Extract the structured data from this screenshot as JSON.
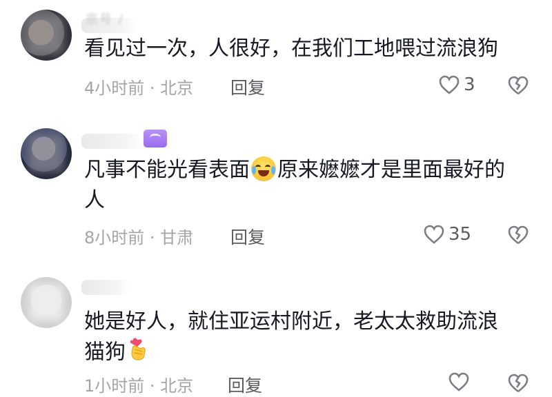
{
  "comments": [
    {
      "user_text": "京号 /",
      "text_lines": [
        "看见过一次，人很好，在我们工地喂过流浪狗"
      ],
      "time_location": "4小时前 · 北京",
      "reply_label": "回复",
      "likes": "3",
      "heart_icon": "heart-outline-icon",
      "dislike_icon": "broken-heart-icon"
    },
    {
      "user_text": "",
      "text_lines": [
        "凡事不能光看表面",
        "原来嬷嬷才是里面最好的",
        "人"
      ],
      "time_location": "8小时前 · 甘肃",
      "reply_label": "回复",
      "likes": "35",
      "badge_color": "#a57ff2",
      "emoji": "tears-of-joy-emoji"
    },
    {
      "user_text": "",
      "text_lines": [
        "她是好人，就住亚运村附近，老太太救助流浪",
        "猫狗"
      ],
      "time_location": "1小时前 · 北京",
      "reply_label": "回复",
      "likes": "",
      "emoji": "finger-heart-emoji"
    }
  ]
}
